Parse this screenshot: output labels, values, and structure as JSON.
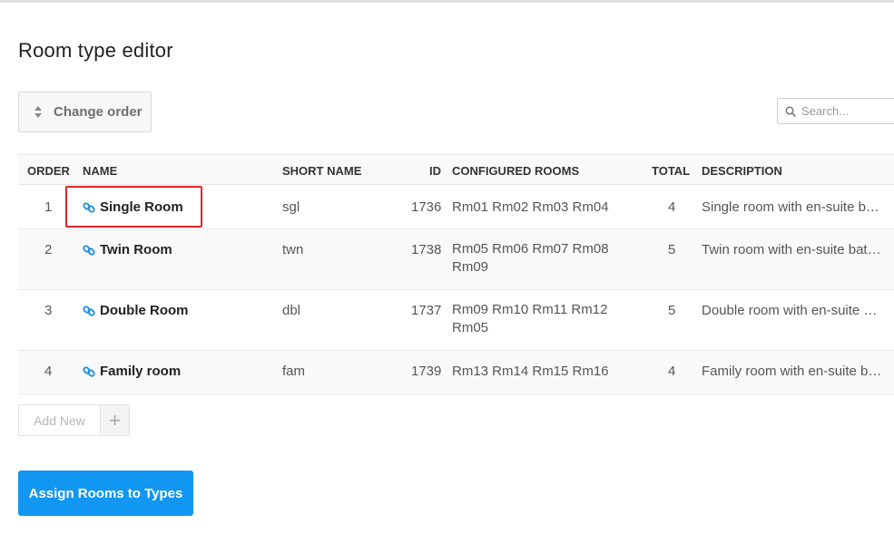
{
  "page": {
    "title": "Room type editor"
  },
  "toolbar": {
    "change_order_label": "Change order"
  },
  "search": {
    "placeholder": "Search..."
  },
  "table": {
    "headers": {
      "order": "ORDER",
      "name": "NAME",
      "short_name": "SHORT NAME",
      "id": "ID",
      "configured_rooms": "CONFIGURED ROOMS",
      "total": "TOTAL",
      "description": "DESCRIPTION"
    },
    "rows": [
      {
        "order": "1",
        "name": "Single Room",
        "short_name": "sgl",
        "id": "1736",
        "rooms": "Rm01 Rm02 Rm03 Rm04",
        "total": "4",
        "description": "Single room with en-suite b…"
      },
      {
        "order": "2",
        "name": "Twin Room",
        "short_name": "twn",
        "id": "1738",
        "rooms": "Rm05 Rm06 Rm07 Rm08 Rm09",
        "total": "5",
        "description": "Twin room with en-suite bat…"
      },
      {
        "order": "3",
        "name": "Double Room",
        "short_name": "dbl",
        "id": "1737",
        "rooms": "Rm09 Rm10 Rm11 Rm12 Rm05",
        "total": "5",
        "description": "Double room with en-suite …"
      },
      {
        "order": "4",
        "name": "Family room",
        "short_name": "fam",
        "id": "1739",
        "rooms": "Rm13 Rm14 Rm15 Rm16",
        "total": "4",
        "description": "Family room with en-suite b…"
      }
    ]
  },
  "add_new": {
    "label": "Add New",
    "plus": "+"
  },
  "assign_button": {
    "label": "Assign Rooms to Types"
  },
  "colors": {
    "accent": "#1196f2",
    "highlight": "#e0262a",
    "link_icon": "#1a8fe3"
  },
  "icons": {
    "sort": "sort-icon",
    "search": "search-icon",
    "link": "link-icon",
    "plus": "plus-icon"
  }
}
